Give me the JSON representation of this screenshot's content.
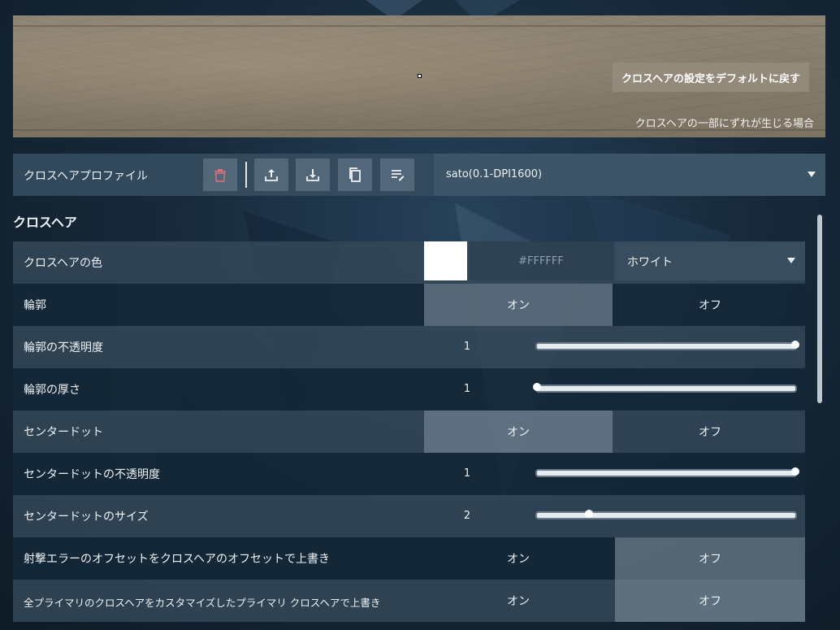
{
  "preview": {
    "reset_button": "クロスヘアの設定をデフォルトに戻す",
    "misalign_link": "クロスヘアの一部にずれが生じる場合"
  },
  "profile": {
    "label": "クロスヘアプロファイル",
    "selected": "sato(0.1-DPI1600)",
    "tools": [
      "trash-icon",
      "upload-icon",
      "download-icon",
      "copy-icon",
      "edit-list-icon"
    ],
    "delete_color": "#e0707a"
  },
  "section": {
    "title": "クロスヘア"
  },
  "settings": {
    "color": {
      "label": "クロスヘアの色",
      "swatch": "#FFFFFF",
      "hex": "#FFFFFF",
      "selected": "ホワイト"
    },
    "outlines": {
      "label": "輪郭",
      "on": "オン",
      "off": "オフ",
      "state": "on"
    },
    "outline_opacity": {
      "label": "輪郭の不透明度",
      "value": "1",
      "fraction": 1.0
    },
    "outline_thickness": {
      "label": "輪郭の厚さ",
      "value": "1",
      "fraction": 0.0
    },
    "center_dot": {
      "label": "センタードット",
      "on": "オン",
      "off": "オフ",
      "state": "on"
    },
    "center_dot_opacity": {
      "label": "センタードットの不透明度",
      "value": "1",
      "fraction": 1.0
    },
    "center_dot_size": {
      "label": "センタードットのサイズ",
      "value": "2",
      "fraction": 0.2
    },
    "override_firing_error": {
      "label": "射撃エラーのオフセットをクロスヘアのオフセットで上書き",
      "on": "オン",
      "off": "オフ",
      "state": "off"
    },
    "override_all_primary": {
      "label": "全プライマリのクロスヘアをカスタマイズしたプライマリ クロスヘアで上書き",
      "on": "オン",
      "off": "オフ",
      "state": "off"
    }
  }
}
